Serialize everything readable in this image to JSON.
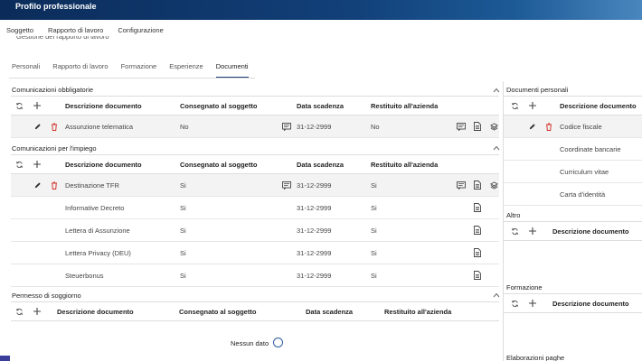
{
  "app": {
    "title": "Profilo professionale"
  },
  "menu": [
    "Soggetto",
    "Rapporto di lavoro",
    "Configurazione"
  ],
  "section_ghost": "Gestione del rapporto di lavoro",
  "subtabs": [
    "Personali",
    "Rapporto di lavoro",
    "Formazione",
    "Esperienze",
    "Documenti"
  ],
  "active_subtab": "Documenti",
  "columns": {
    "desc": "Descrizione documento",
    "consegnato": "Consegnato al soggetto",
    "scadenza": "Data scadenza",
    "restituito": "Restituito all'azienda"
  },
  "obbligatorie": {
    "title": "Comunicazioni obbligatorie",
    "rows": [
      {
        "desc": "Assunzione telematica",
        "consegnato": "No",
        "scadenza": "31-12-2999",
        "restituito": "No"
      }
    ]
  },
  "impiego": {
    "title": "Comunicazioni per l'impiego",
    "rows": [
      {
        "desc": "Destinazione TFR",
        "consegnato": "Si",
        "scadenza": "31-12-2999",
        "restituito": "Si"
      },
      {
        "desc": "Informative Decreto",
        "consegnato": "Si",
        "scadenza": "31-12-2999",
        "restituito": "Si"
      },
      {
        "desc": "Lettera di Assunzione",
        "consegnato": "Si",
        "scadenza": "31-12-2999",
        "restituito": "Si"
      },
      {
        "desc": "Lettera Privacy (DEU)",
        "consegnato": "Si",
        "scadenza": "31-12-2999",
        "restituito": "Si"
      },
      {
        "desc": "Steuerbonus",
        "consegnato": "Si",
        "scadenza": "31-12-2999",
        "restituito": "Si"
      }
    ]
  },
  "soggiorno": {
    "title": "Permesso di soggiorno",
    "empty": "Nessun dato"
  },
  "right": {
    "personali": {
      "title": "Documenti personali",
      "col": "Descrizione documento",
      "rows": [
        "Codice fiscale",
        "Coordinate bancarie",
        "Curriculum vitae",
        "Carta d'identità"
      ]
    },
    "altro": {
      "title": "Altro",
      "col": "Descrizione documento"
    },
    "formazione": {
      "title": "Formazione",
      "col": "Descrizione documento"
    },
    "elaborazioni": {
      "title": "Elaborazioni paghe"
    }
  }
}
